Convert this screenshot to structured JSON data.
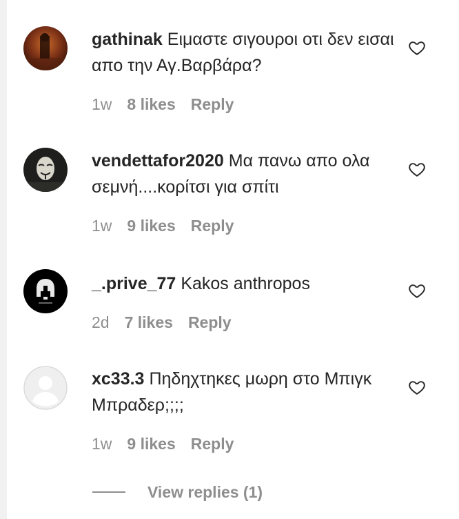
{
  "comments": [
    {
      "username": "gathinak",
      "text": "Ειμαστε σιγουροι οτι δεν εισαι απο την Αγ.Βαρβάρα?",
      "time": "1w",
      "likes": "8 likes",
      "reply": "Reply",
      "avatar": "photo-avatar"
    },
    {
      "username": "vendettafor2020",
      "text": "Μα πανω απο ολα σεμνή....κορίτσι για σπίτι",
      "time": "1w",
      "likes": "9 likes",
      "reply": "Reply",
      "avatar": "mask-avatar"
    },
    {
      "username": "_.prive_77",
      "text": "Kakos anthropos",
      "time": "2d",
      "likes": "7 likes",
      "reply": "Reply",
      "avatar": "spartan-helmet-avatar"
    },
    {
      "username": "xc33.3",
      "text": "Πηδηχτηκες μωρη στο Μπιγκ Μπραδερ;;;;",
      "time": "1w",
      "likes": "9 likes",
      "reply": "Reply",
      "avatar": "default-avatar"
    }
  ],
  "view_replies": "View replies (1)",
  "colors": {
    "text": "#262626",
    "meta": "#8e8e8e",
    "background": "#ffffff"
  }
}
